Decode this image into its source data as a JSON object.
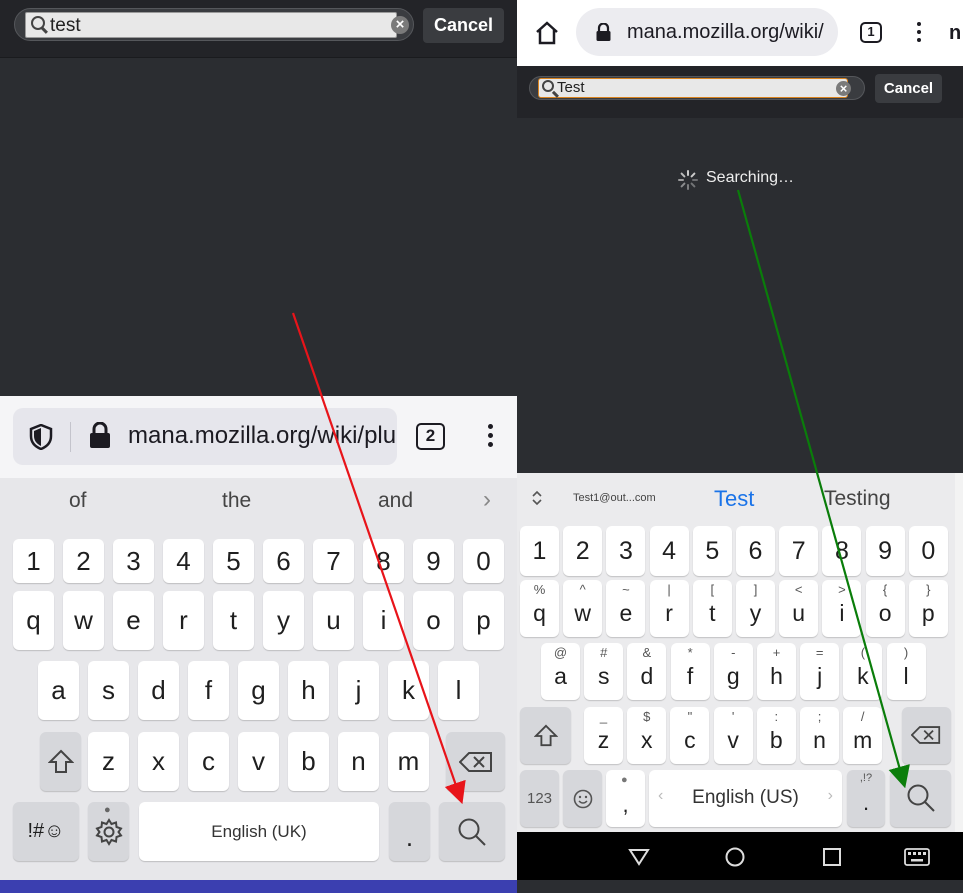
{
  "left": {
    "search": {
      "value": "test",
      "cancel_label": "Cancel"
    },
    "toolbar": {
      "url": "mana.mozilla.org/wiki/plug",
      "tab_count": "2"
    },
    "keyboard": {
      "suggestions": [
        "of",
        "the",
        "and"
      ],
      "rows": [
        [
          "1",
          "2",
          "3",
          "4",
          "5",
          "6",
          "7",
          "8",
          "9",
          "0"
        ],
        [
          "q",
          "w",
          "e",
          "r",
          "t",
          "y",
          "u",
          "i",
          "o",
          "p"
        ],
        [
          "a",
          "s",
          "d",
          "f",
          "g",
          "h",
          "j",
          "k",
          "l"
        ],
        [
          "z",
          "x",
          "c",
          "v",
          "b",
          "n",
          "m"
        ]
      ],
      "symbols_label": "!#☺",
      "space_label": "English (UK)",
      "period_label": "."
    }
  },
  "right": {
    "toolbar": {
      "url": "mana.mozilla.org/wiki/",
      "tab_count": "1"
    },
    "search": {
      "value": "Test",
      "cancel_label": "Cancel"
    },
    "status": "Searching…",
    "keyboard": {
      "suggestion_email": "Test1@out...com",
      "suggestions": [
        "Test",
        "Testing"
      ],
      "numbers": [
        "1",
        "2",
        "3",
        "4",
        "5",
        "6",
        "7",
        "8",
        "9",
        "0"
      ],
      "row1": [
        [
          "%",
          "q"
        ],
        [
          "^",
          "w"
        ],
        [
          "~",
          "e"
        ],
        [
          "|",
          "r"
        ],
        [
          "[",
          "t"
        ],
        [
          "]",
          "y"
        ],
        [
          "<",
          "u"
        ],
        [
          ">",
          "i"
        ],
        [
          "{",
          "o"
        ],
        [
          "}",
          "p"
        ]
      ],
      "row2": [
        [
          "@",
          "a"
        ],
        [
          "#",
          "s"
        ],
        [
          "&",
          "d"
        ],
        [
          "*",
          "f"
        ],
        [
          "-",
          "g"
        ],
        [
          "+",
          "h"
        ],
        [
          "=",
          "j"
        ],
        [
          "(",
          "k"
        ],
        [
          ")",
          "l"
        ]
      ],
      "row3": [
        [
          "_",
          "z"
        ],
        [
          "$",
          "x"
        ],
        [
          "\"",
          "c"
        ],
        [
          "'",
          "v"
        ],
        [
          ":",
          "b"
        ],
        [
          ";",
          "n"
        ],
        [
          "/",
          "m"
        ]
      ],
      "mode_label": "123",
      "space_label": "English (US)",
      "comma_label": ",",
      "period_label": ".",
      "period_sup": ",!?"
    }
  },
  "annotations": {
    "left_arrow_color": "#e8141a",
    "right_arrow_color": "#0a7d0a"
  },
  "colors": {
    "accent_blue": "#1a73e8",
    "dark_bg": "#2b2d31",
    "left_bottom_bar": "#3b3fb0"
  }
}
